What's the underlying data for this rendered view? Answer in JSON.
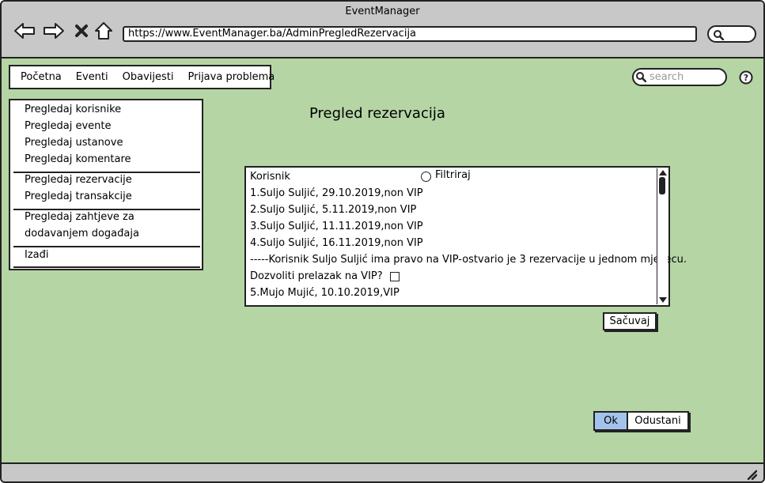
{
  "browser": {
    "title": "EventManager",
    "url": "https://www.EventManager.ba/AdminPregledRezervacija"
  },
  "menu": {
    "items": [
      "Početna",
      "Eventi",
      "Obavijesti",
      "Prijava problema"
    ]
  },
  "search": {
    "placeholder": "search"
  },
  "sidebar": {
    "items": [
      "Pregledaj korisnike",
      "Pregledaj evente",
      "Pregledaj ustanove",
      "Pregledaj komentare",
      "Pregledaj rezervacije",
      "Pregledaj transakcije",
      "Pregledaj zahtjeve za",
      "dodavanjem događaja",
      "Izađi"
    ]
  },
  "main": {
    "title": "Pregled rezervacija",
    "list": {
      "header": "Korisnik",
      "filter_label": "Filtriraj",
      "rows": [
        "1.Suljo Suljić, 29.10.2019,non VIP",
        "2.Suljo Suljić, 5.11.2019,non VIP",
        "3.Suljo Suljić, 11.11.2019,non VIP",
        "4.Suljo Suljić, 16.11.2019,non VIP",
        "-----Korisnik Suljo Suljić ima pravo na VIP-ostvario je 3 rezervacije u jednom mjesecu.",
        "Dozvoliti prelazak na VIP?",
        "5.Mujo Mujić, 10.10.2019,VIP"
      ]
    },
    "save_label": "Sačuvaj",
    "ok_label": "Ok",
    "cancel_label": "Odustani"
  },
  "colors": {
    "page_background": "#b5d5a5",
    "chrome": "#c8c8c8",
    "ok_button": "#a4c3ec"
  }
}
